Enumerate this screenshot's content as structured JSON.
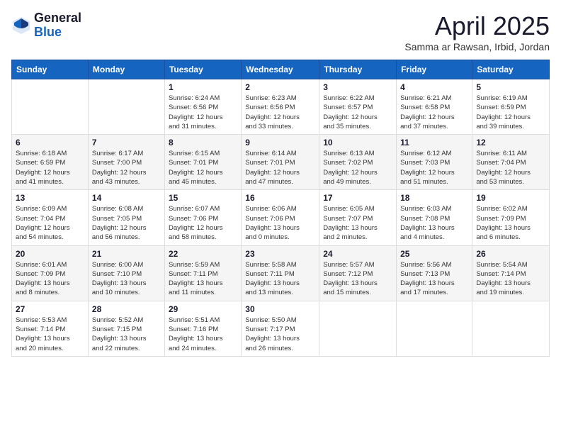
{
  "logo": {
    "general": "General",
    "blue": "Blue"
  },
  "title": "April 2025",
  "subtitle": "Samma ar Rawsan, Irbid, Jordan",
  "days_of_week": [
    "Sunday",
    "Monday",
    "Tuesday",
    "Wednesday",
    "Thursday",
    "Friday",
    "Saturday"
  ],
  "weeks": [
    [
      {
        "day": "",
        "info": ""
      },
      {
        "day": "",
        "info": ""
      },
      {
        "day": "1",
        "info": "Sunrise: 6:24 AM\nSunset: 6:56 PM\nDaylight: 12 hours\nand 31 minutes."
      },
      {
        "day": "2",
        "info": "Sunrise: 6:23 AM\nSunset: 6:56 PM\nDaylight: 12 hours\nand 33 minutes."
      },
      {
        "day": "3",
        "info": "Sunrise: 6:22 AM\nSunset: 6:57 PM\nDaylight: 12 hours\nand 35 minutes."
      },
      {
        "day": "4",
        "info": "Sunrise: 6:21 AM\nSunset: 6:58 PM\nDaylight: 12 hours\nand 37 minutes."
      },
      {
        "day": "5",
        "info": "Sunrise: 6:19 AM\nSunset: 6:59 PM\nDaylight: 12 hours\nand 39 minutes."
      }
    ],
    [
      {
        "day": "6",
        "info": "Sunrise: 6:18 AM\nSunset: 6:59 PM\nDaylight: 12 hours\nand 41 minutes."
      },
      {
        "day": "7",
        "info": "Sunrise: 6:17 AM\nSunset: 7:00 PM\nDaylight: 12 hours\nand 43 minutes."
      },
      {
        "day": "8",
        "info": "Sunrise: 6:15 AM\nSunset: 7:01 PM\nDaylight: 12 hours\nand 45 minutes."
      },
      {
        "day": "9",
        "info": "Sunrise: 6:14 AM\nSunset: 7:01 PM\nDaylight: 12 hours\nand 47 minutes."
      },
      {
        "day": "10",
        "info": "Sunrise: 6:13 AM\nSunset: 7:02 PM\nDaylight: 12 hours\nand 49 minutes."
      },
      {
        "day": "11",
        "info": "Sunrise: 6:12 AM\nSunset: 7:03 PM\nDaylight: 12 hours\nand 51 minutes."
      },
      {
        "day": "12",
        "info": "Sunrise: 6:11 AM\nSunset: 7:04 PM\nDaylight: 12 hours\nand 53 minutes."
      }
    ],
    [
      {
        "day": "13",
        "info": "Sunrise: 6:09 AM\nSunset: 7:04 PM\nDaylight: 12 hours\nand 54 minutes."
      },
      {
        "day": "14",
        "info": "Sunrise: 6:08 AM\nSunset: 7:05 PM\nDaylight: 12 hours\nand 56 minutes."
      },
      {
        "day": "15",
        "info": "Sunrise: 6:07 AM\nSunset: 7:06 PM\nDaylight: 12 hours\nand 58 minutes."
      },
      {
        "day": "16",
        "info": "Sunrise: 6:06 AM\nSunset: 7:06 PM\nDaylight: 13 hours\nand 0 minutes."
      },
      {
        "day": "17",
        "info": "Sunrise: 6:05 AM\nSunset: 7:07 PM\nDaylight: 13 hours\nand 2 minutes."
      },
      {
        "day": "18",
        "info": "Sunrise: 6:03 AM\nSunset: 7:08 PM\nDaylight: 13 hours\nand 4 minutes."
      },
      {
        "day": "19",
        "info": "Sunrise: 6:02 AM\nSunset: 7:09 PM\nDaylight: 13 hours\nand 6 minutes."
      }
    ],
    [
      {
        "day": "20",
        "info": "Sunrise: 6:01 AM\nSunset: 7:09 PM\nDaylight: 13 hours\nand 8 minutes."
      },
      {
        "day": "21",
        "info": "Sunrise: 6:00 AM\nSunset: 7:10 PM\nDaylight: 13 hours\nand 10 minutes."
      },
      {
        "day": "22",
        "info": "Sunrise: 5:59 AM\nSunset: 7:11 PM\nDaylight: 13 hours\nand 11 minutes."
      },
      {
        "day": "23",
        "info": "Sunrise: 5:58 AM\nSunset: 7:11 PM\nDaylight: 13 hours\nand 13 minutes."
      },
      {
        "day": "24",
        "info": "Sunrise: 5:57 AM\nSunset: 7:12 PM\nDaylight: 13 hours\nand 15 minutes."
      },
      {
        "day": "25",
        "info": "Sunrise: 5:56 AM\nSunset: 7:13 PM\nDaylight: 13 hours\nand 17 minutes."
      },
      {
        "day": "26",
        "info": "Sunrise: 5:54 AM\nSunset: 7:14 PM\nDaylight: 13 hours\nand 19 minutes."
      }
    ],
    [
      {
        "day": "27",
        "info": "Sunrise: 5:53 AM\nSunset: 7:14 PM\nDaylight: 13 hours\nand 20 minutes."
      },
      {
        "day": "28",
        "info": "Sunrise: 5:52 AM\nSunset: 7:15 PM\nDaylight: 13 hours\nand 22 minutes."
      },
      {
        "day": "29",
        "info": "Sunrise: 5:51 AM\nSunset: 7:16 PM\nDaylight: 13 hours\nand 24 minutes."
      },
      {
        "day": "30",
        "info": "Sunrise: 5:50 AM\nSunset: 7:17 PM\nDaylight: 13 hours\nand 26 minutes."
      },
      {
        "day": "",
        "info": ""
      },
      {
        "day": "",
        "info": ""
      },
      {
        "day": "",
        "info": ""
      }
    ]
  ]
}
